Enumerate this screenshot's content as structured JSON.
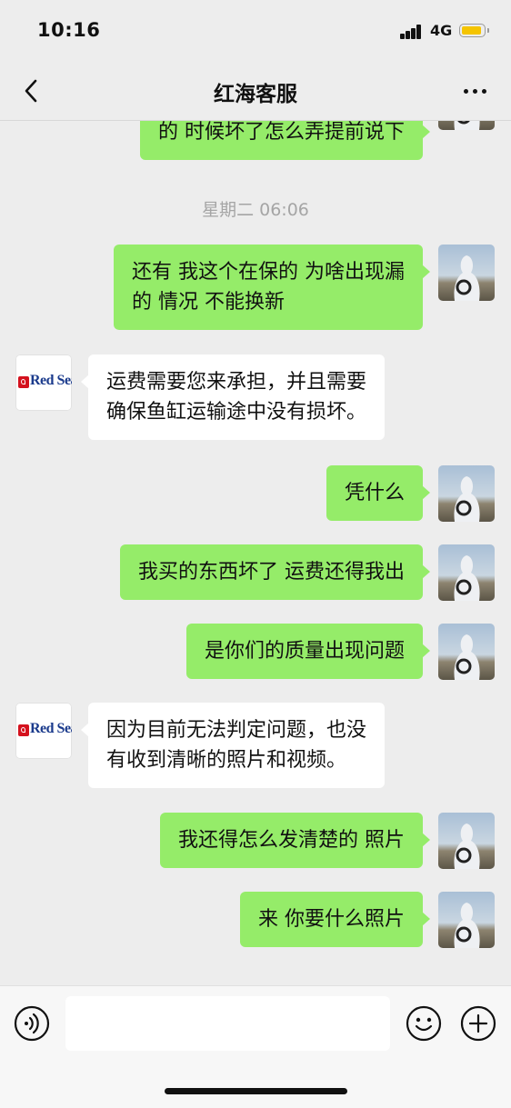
{
  "status_bar": {
    "time": "10:16",
    "network": "4G"
  },
  "header": {
    "title": "红海客服",
    "back_icon": "chevron-left-icon",
    "more_icon": "more-dots-icon"
  },
  "timestamp": "星期二 06:06",
  "brand_avatar": {
    "text": "Red Sea",
    "accent": "#d4121e",
    "text_color": "#1a3a8c"
  },
  "messages": [
    {
      "side": "right",
      "text": "的 时候坏了怎么弄提前说下"
    },
    {
      "side": "right",
      "text": "还有 我这个在保的 为啥出现漏\n的 情况 不能换新"
    },
    {
      "side": "left",
      "text": "运费需要您来承担，并且需要\n确保鱼缸运输途中没有损坏。"
    },
    {
      "side": "right",
      "text": "凭什么"
    },
    {
      "side": "right",
      "text": "我买的东西坏了 运费还得我出"
    },
    {
      "side": "right",
      "text": "是你们的质量出现问题"
    },
    {
      "side": "left",
      "text": "因为目前无法判定问题，也没\n有收到清晰的照片和视频。"
    },
    {
      "side": "right",
      "text": "我还得怎么发清楚的 照片"
    },
    {
      "side": "right",
      "text": "来 你要什么照片"
    }
  ],
  "input_bar": {
    "placeholder": "",
    "voice_icon": "voice-icon",
    "emoji_icon": "emoji-icon",
    "plus_icon": "plus-icon"
  },
  "colors": {
    "self_bubble": "#95ec69",
    "other_bubble": "#ffffff",
    "background": "#ededed"
  }
}
